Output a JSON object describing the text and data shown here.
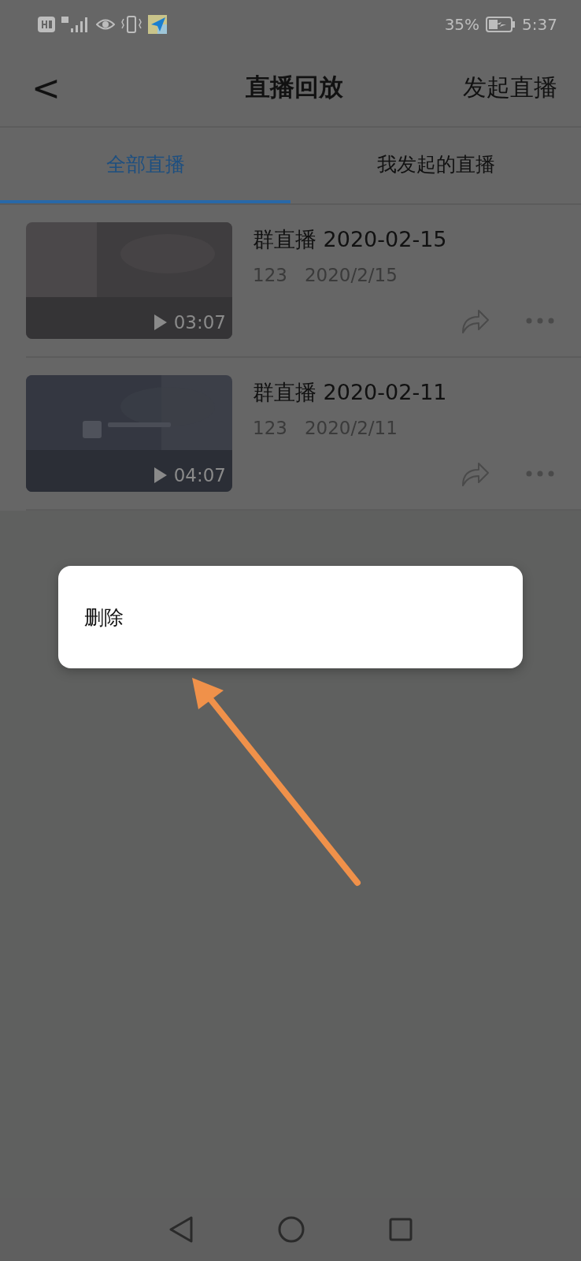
{
  "status_bar": {
    "battery": "35%",
    "time": "5:37"
  },
  "header": {
    "back": "<",
    "title": "直播回放",
    "action": "发起直播"
  },
  "tabs": [
    {
      "label": "全部直播",
      "selected": true
    },
    {
      "label": "我发起的直播",
      "selected": false
    }
  ],
  "videos": [
    {
      "title": "群直播 2020-02-15",
      "author": "123",
      "date": "2020/2/15",
      "duration": "03:07",
      "kind": "picture"
    },
    {
      "title": "群直播 2020-02-11",
      "author": "123",
      "date": "2020/2/11",
      "duration": "04:07",
      "kind": "picture"
    }
  ],
  "menu": {
    "items": [
      "删除"
    ]
  }
}
